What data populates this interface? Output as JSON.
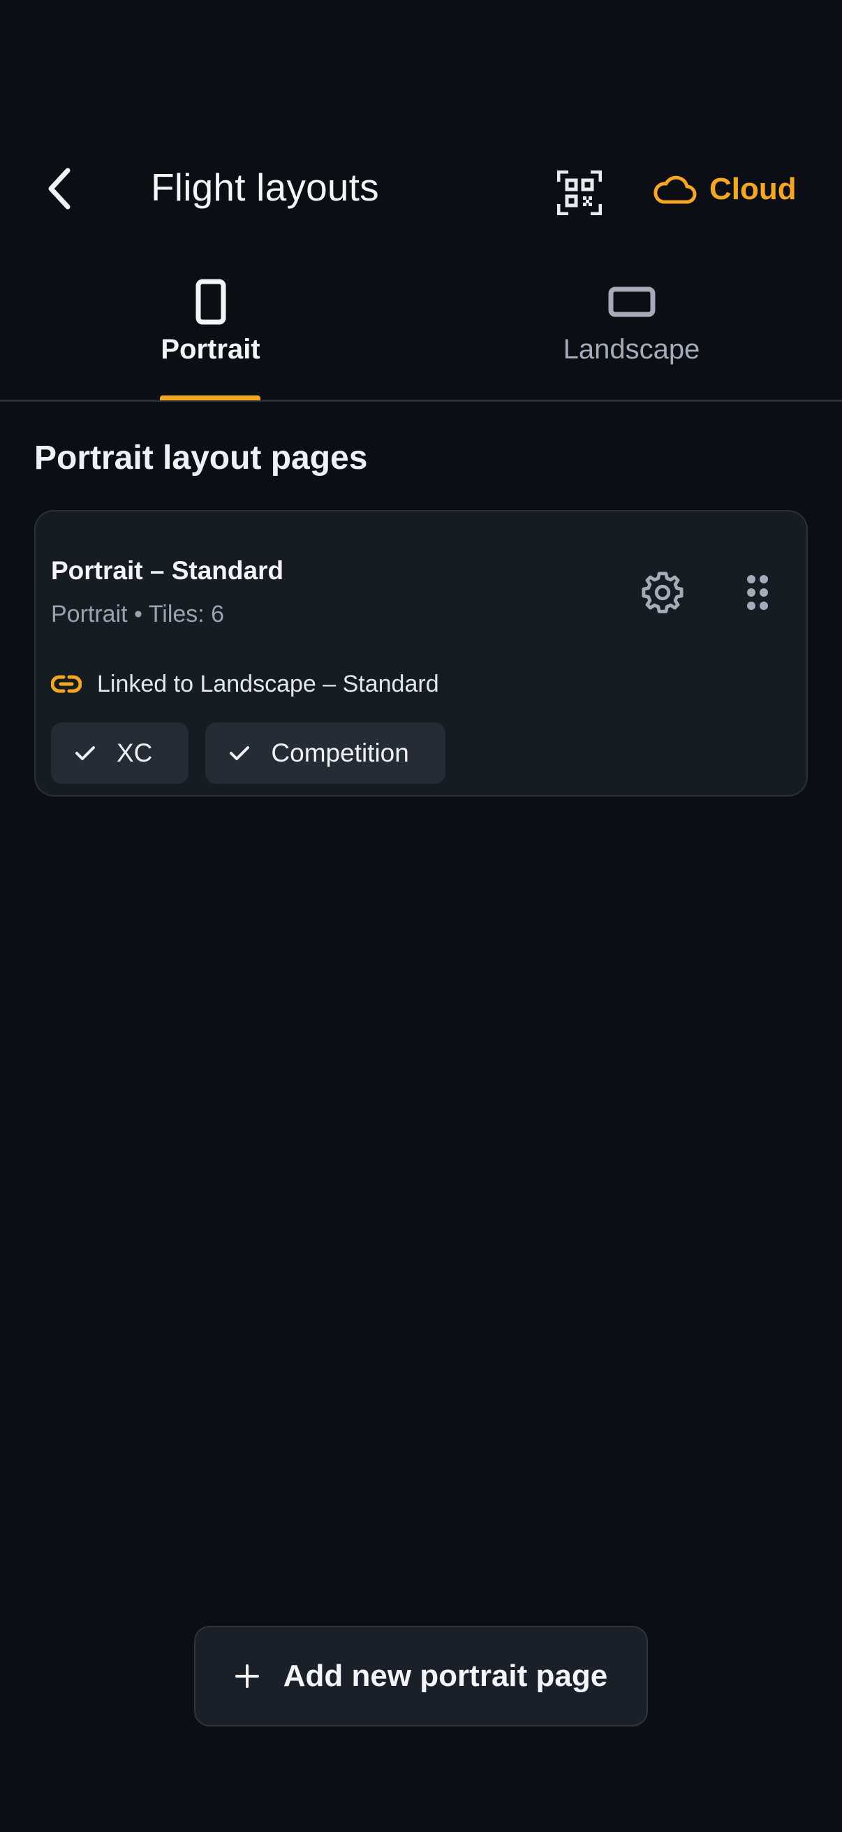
{
  "header": {
    "title": "Flight layouts",
    "back_icon": "chevron-left-icon",
    "qr_icon": "qr-code-icon",
    "cloud_icon": "cloud-icon",
    "cloud_label": "Cloud"
  },
  "tabs": [
    {
      "label": "Portrait",
      "icon": "phone-portrait-icon",
      "selected": true
    },
    {
      "label": "Landscape",
      "icon": "phone-landscape-icon",
      "selected": false
    }
  ],
  "section": {
    "title": "Portrait layout pages"
  },
  "cards": [
    {
      "title": "Portrait – Standard",
      "subtitle": "Portrait • Tiles: 6",
      "linked_text": "Linked to Landscape – Standard",
      "chips": [
        {
          "label": "XC",
          "checked": true
        },
        {
          "label": "Competition",
          "checked": true
        }
      ]
    }
  ],
  "add_button": {
    "label": "Add new portrait page"
  },
  "colors": {
    "background": "#0b0e14",
    "accent": "#f5a623",
    "card": "#161c24",
    "chip": "#252c36"
  }
}
